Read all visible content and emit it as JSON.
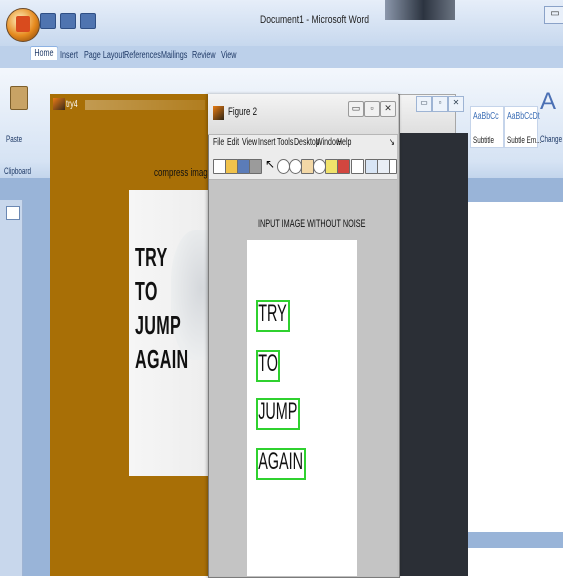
{
  "word": {
    "window_title": "Document1 - Microsoft Word",
    "window_controls": {
      "minimize": "▭"
    },
    "tabs": [
      "Home",
      "Insert",
      "Page Layout",
      "References",
      "Mailings",
      "Review",
      "View"
    ],
    "ribbon": {
      "paste_label": "Paste",
      "clipboard_group": "Clipboard",
      "styles": [
        {
          "sample": "AaBbCc",
          "label": "Subtitle"
        },
        {
          "sample": "AaBbCcDt",
          "label": "Subtle Em..."
        }
      ],
      "change_styles_label": "Change Styles"
    }
  },
  "try4_window": {
    "title": "try4",
    "image_title": "compress image",
    "image_words": [
      "TRY",
      "TO",
      "JUMP",
      "AGAIN"
    ]
  },
  "figure2_window": {
    "title": "Figure 2",
    "menu": [
      "File",
      "Edit",
      "View",
      "Insert",
      "Tools",
      "Desktop",
      "Window",
      "Help"
    ],
    "toolbar_icons": [
      "new-file-icon",
      "open-icon",
      "save-icon",
      "print-icon",
      "arrow-icon",
      "zoom-in-icon",
      "zoom-out-icon",
      "pan-icon",
      "rotate-icon",
      "data-cursor-icon",
      "brush-icon",
      "link-icon",
      "colorbar-icon",
      "legend-icon",
      "hide-tools-icon"
    ],
    "caption": "INPUT IMAGE WITHOUT NOISE",
    "detected_words": [
      "TRY",
      "TO",
      "JUMP",
      "AGAIN"
    ],
    "box_color": "#2fd12f"
  },
  "accent_colors": {
    "matlab_figure_bg": "#a86f06",
    "word_ribbon": "#d6e3f4"
  }
}
